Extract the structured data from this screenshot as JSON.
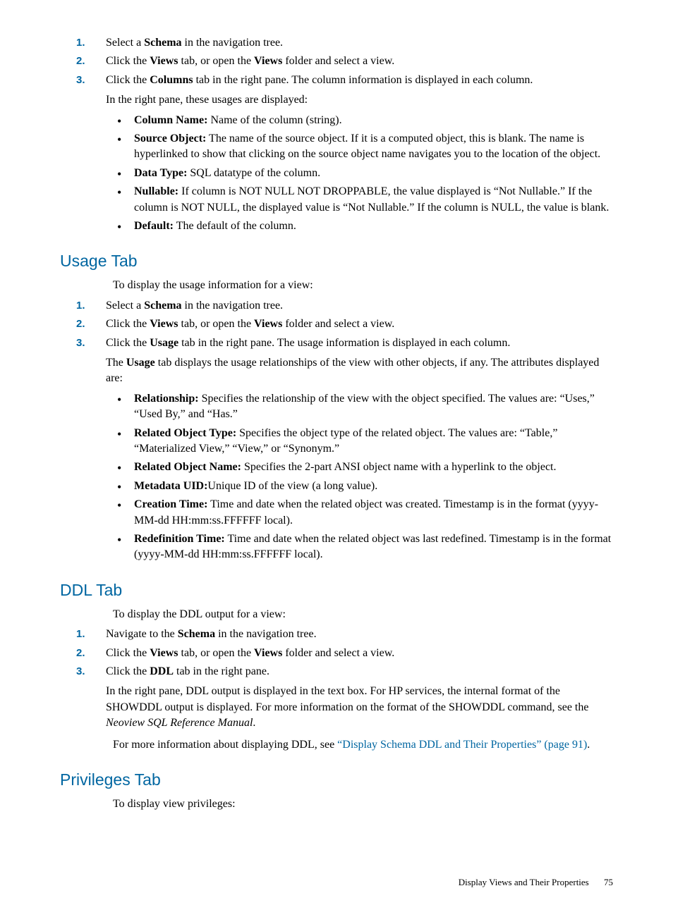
{
  "section1": {
    "step1_num": "1.",
    "step1": "Select a ",
    "step1_b": "Schema",
    "step1_end": " in the navigation tree.",
    "step2_num": "2.",
    "step2_a": "Click the ",
    "step2_b": "Views",
    "step2_c": " tab, or open the ",
    "step2_d": "Views",
    "step2_e": " folder and select a view.",
    "step3_num": "3.",
    "step3_a": "Click the ",
    "step3_b": "Columns",
    "step3_c": " tab in the right pane. The column information is displayed in each column.",
    "step3_para": "In the right pane, these usages are displayed:",
    "b1_label": "Column Name:",
    "b1_text": " Name of the column (string).",
    "b2_label": "Source Object:",
    "b2_text": " The name of the source object. If it is a computed object, this is blank. The name is hyperlinked to show that clicking on the source object name navigates you to the location of the object.",
    "b3_label": "Data Type:",
    "b3_text": " SQL datatype of the column.",
    "b4_label": "Nullable:",
    "b4_text": " If column is NOT NULL NOT DROPPABLE, the value displayed is “Not Nullable.” If the column is NOT NULL, the displayed value is “Not Nullable.” If the column is NULL, the value is blank.",
    "b5_label": "Default:",
    "b5_text": " The default of the column."
  },
  "usage": {
    "heading": "Usage Tab",
    "intro": "To display the usage information for a view:",
    "step1_num": "1.",
    "step1_a": "Select a ",
    "step1_b": "Schema",
    "step1_c": " in the navigation tree.",
    "step2_num": "2.",
    "step2_a": "Click the ",
    "step2_b": "Views",
    "step2_c": " tab, or open the ",
    "step2_d": "Views",
    "step2_e": " folder and select a view.",
    "step3_num": "3.",
    "step3_a": "Click the ",
    "step3_b": "Usage",
    "step3_c": " tab in the right pane. The usage information is displayed in each column.",
    "step3_para_a": "The ",
    "step3_para_b": "Usage",
    "step3_para_c": " tab displays the usage relationships of the view with other objects, if any. The attributes displayed are:",
    "b1_label": "Relationship:",
    "b1_text": " Specifies the relationship of the view with the object specified. The values are: “Uses,” “Used By,” and “Has.”",
    "b2_label": "Related Object Type:",
    "b2_text": " Specifies the object type of the related object. The values are: “Table,” “Materialized View,” “View,” or “Synonym.”",
    "b3_label": "Related Object Name:",
    "b3_text": " Specifies the 2-part ANSI object name with a hyperlink to the object.",
    "b4_label": "Metadata UID:",
    "b4_text": "Unique ID of the view (a long value).",
    "b5_label": "Creation Time:",
    "b5_text": " Time and date when the related object was created. Timestamp is in the format (yyyy-MM-dd HH:mm:ss.FFFFFF local).",
    "b6_label": "Redefinition Time:",
    "b6_text": " Time and date when the related object was last redefined. Timestamp is in the format (yyyy-MM-dd HH:mm:ss.FFFFFF local)."
  },
  "ddl": {
    "heading": "DDL Tab",
    "intro": "To display the DDL output for a view:",
    "step1_num": "1.",
    "step1_a": "Navigate to the ",
    "step1_b": "Schema",
    "step1_c": " in the navigation tree.",
    "step2_num": "2.",
    "step2_a": "Click the ",
    "step2_b": "Views",
    "step2_c": " tab, or open the ",
    "step2_d": "Views",
    "step2_e": " folder and select a view.",
    "step3_num": "3.",
    "step3_a": "Click the ",
    "step3_b": "DDL",
    "step3_c": " tab in the right pane.",
    "step3_para_a": "In the right pane, DDL output is displayed in the text box. For HP services, the internal format of the SHOWDDL output is displayed. For more information on the format of the SHOWDDL command, see the ",
    "step3_para_italic": "Neoview SQL Reference Manual",
    "step3_para_end": ".",
    "more_a": "For more information about displaying DDL, see ",
    "more_link": "“Display Schema DDL and Their Properties” (page 91)",
    "more_end": "."
  },
  "privileges": {
    "heading": "Privileges Tab",
    "intro": "To display view privileges:"
  },
  "footer": {
    "title": "Display Views and Their Properties",
    "pagenum": "75"
  }
}
